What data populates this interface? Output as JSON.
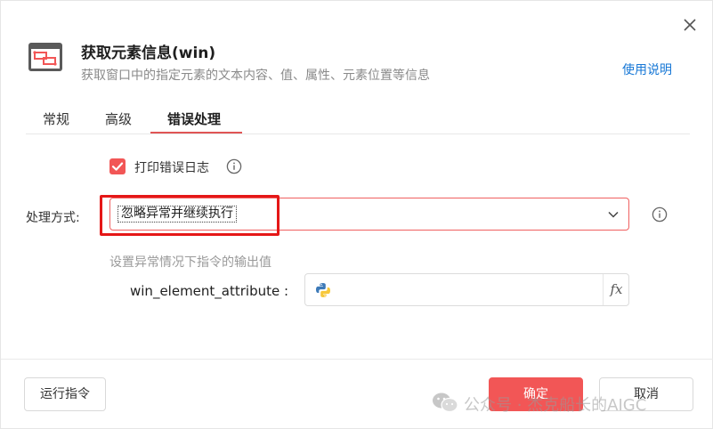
{
  "dialog": {
    "title": "获取元素信息(win)",
    "subtitle": "获取窗口中的指定元素的文本内容、值、属性、元素位置等信息",
    "help_link": "使用说明",
    "icon": "window-element-icon"
  },
  "tabs": [
    {
      "label": "常规",
      "active": false
    },
    {
      "label": "高级",
      "active": false
    },
    {
      "label": "错误处理",
      "active": true
    }
  ],
  "error_handling": {
    "log_checkbox_label": "打印错误日志",
    "log_checkbox_checked": true,
    "method_label": "处理方式:",
    "method_value": "忽略异常并继续执行",
    "output_hint": "设置异常情况下指令的输出值",
    "variable_label": "win_element_attribute :",
    "variable_value": "",
    "fx_label": "fx"
  },
  "footer": {
    "run_label": "运行指令",
    "ok_label": "确定",
    "cancel_label": "取消"
  },
  "watermark": {
    "text": "公众号 · 杰克船长的AIGC"
  },
  "colors": {
    "accent": "#f25656",
    "link": "#1677d6",
    "highlight": "#e51717"
  }
}
